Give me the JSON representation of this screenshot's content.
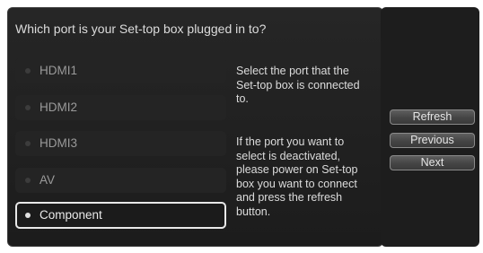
{
  "dialog": {
    "question": "Which port is your Set-top box plugged in to?",
    "ports": [
      {
        "label": "HDMI1",
        "selected": false
      },
      {
        "label": "HDMI2",
        "selected": false
      },
      {
        "label": "HDMI3",
        "selected": false
      },
      {
        "label": "AV",
        "selected": false
      },
      {
        "label": "Component",
        "selected": true
      }
    ],
    "help_primary": "Select the port that the\nSet-top box is connected\nto.",
    "help_secondary": "If the port you want to\nselect is deactivated,\nplease power on Set-top\nbox you want to connect\nand press the refresh\nbutton."
  },
  "buttons": {
    "refresh": "Refresh",
    "previous": "Previous",
    "next": "Next"
  },
  "colors": {
    "panel_bg": "#222222",
    "text": "#dcdcdc",
    "item_bg": "#242424",
    "selected_border": "#e8e8e8"
  }
}
